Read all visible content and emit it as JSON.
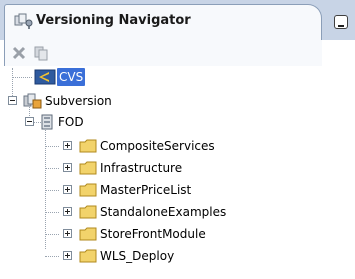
{
  "panel": {
    "title": "Versioning Navigator",
    "icon": "versioning-navigator-icon",
    "minimize_icon": "minimize-icon"
  },
  "toolbar": {
    "buttons": [
      {
        "icon": "delete-x-icon",
        "enabled": false
      },
      {
        "icon": "refresh-icon",
        "enabled": false
      }
    ]
  },
  "tree": {
    "cvs": {
      "label": "CVS",
      "icon": "cvs-icon",
      "selected": true
    },
    "subversion": {
      "label": "Subversion",
      "icon": "subversion-repository-icon",
      "expanded": true
    },
    "fod": {
      "label": "FOD",
      "icon": "repository-connection-icon",
      "expanded": true
    },
    "folders": [
      {
        "label": "CompositeServices",
        "icon": "folder-icon"
      },
      {
        "label": "Infrastructure",
        "icon": "folder-icon"
      },
      {
        "label": "MasterPriceList",
        "icon": "folder-icon"
      },
      {
        "label": "StandaloneExamples",
        "icon": "folder-icon"
      },
      {
        "label": "StoreFrontModule",
        "icon": "folder-icon"
      },
      {
        "label": "WLS_Deploy",
        "icon": "folder-icon"
      }
    ]
  },
  "colors": {
    "tab_background": "#c8d4e6",
    "selection": "#3a6fd8",
    "folder": "#f2d36b"
  }
}
